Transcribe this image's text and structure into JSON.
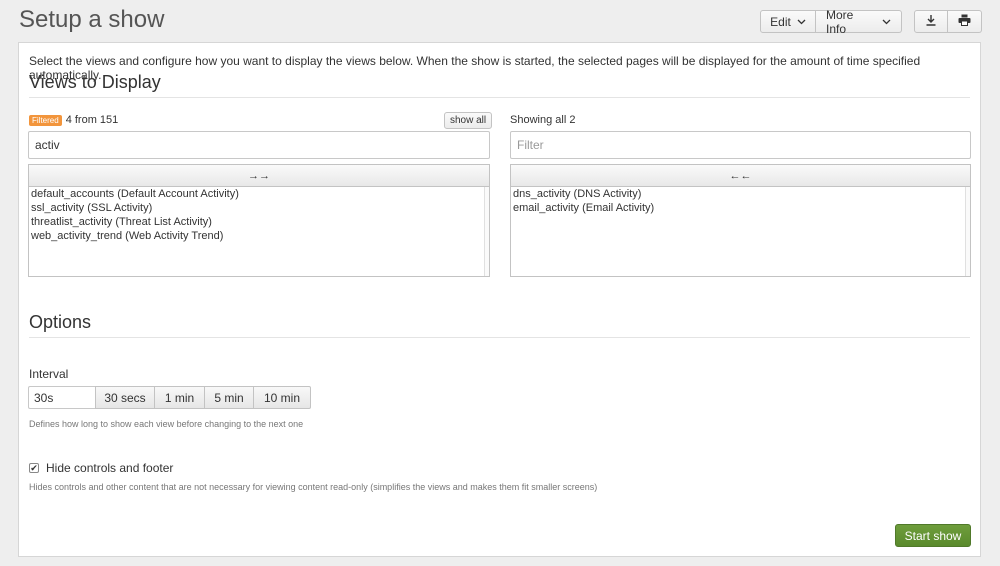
{
  "page": {
    "title": "Setup a show"
  },
  "toolbar": {
    "edit_label": "Edit",
    "more_info_label": "More Info"
  },
  "intro_text": "Select the views and configure how you want to display the views below. When the show is started, the selected pages will be displayed for the amount of time specified automatically.",
  "views": {
    "title": "Views to Display",
    "available": {
      "badge": "Filtered",
      "count_text": "4 from 151",
      "show_all_label": "show all",
      "filter_value": "activ",
      "move_label": "→→",
      "items": [
        "default_accounts (Default Account Activity)",
        "ssl_activity (SSL Activity)",
        "threatlist_activity (Threat List Activity)",
        "web_activity_trend (Web Activity Trend)"
      ]
    },
    "selected": {
      "count_text": "Showing all 2",
      "filter_placeholder": "Filter",
      "move_label": "←←",
      "items": [
        "dns_activity (DNS Activity)",
        "email_activity (Email Activity)"
      ]
    }
  },
  "options": {
    "title": "Options",
    "interval": {
      "label": "Interval",
      "value": "30s",
      "presets": [
        "30 secs",
        "1 min",
        "5 min",
        "10 min"
      ],
      "help": "Defines how long to show each view before changing to the next one"
    },
    "hide_controls": {
      "label": "Hide controls and footer",
      "checked": true,
      "help": "Hides controls and other content that are not necessary for viewing content read-only (simplifies the views and makes them fit smaller screens)"
    }
  },
  "start_button_label": "Start show",
  "icons": {
    "download": "download-icon",
    "print": "print-icon",
    "dropdown": "chevron-down-icon"
  },
  "colors": {
    "primary": "#5c8c2e",
    "filter_badge": "#f2953c"
  }
}
